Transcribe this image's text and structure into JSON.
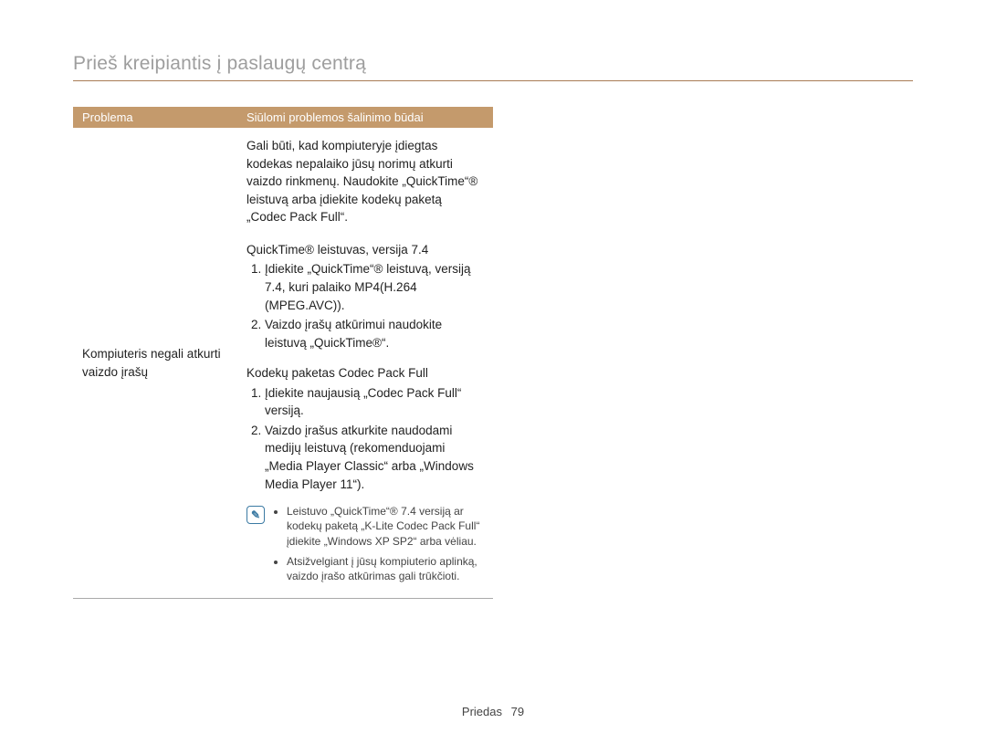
{
  "heading": "Prieš kreipiantis į paslaugų centrą",
  "table": {
    "headers": {
      "problem": "Problema",
      "solution": "Siūlomi problemos šalinimo būdai"
    },
    "row": {
      "problem": "Kompiuteris negali atkurti vaizdo įrašų",
      "intro": "Gali būti, kad kompiuteryje įdiegtas kodekas nepalaiko jūsų norimų atkurti vaizdo rinkmenų. Naudokite „QuickTime“® leistuvą arba įdiekite kodekų paketą „Codec Pack Full“.",
      "groupA": {
        "title": "QuickTime® leistuvas, versija 7.4",
        "steps": [
          "Įdiekite „QuickTime“® leistuvą, versiją 7.4, kuri palaiko MP4(H.264 (MPEG.AVC)).",
          "Vaizdo įrašų atkūrimui naudokite leistuvą „QuickTime®“."
        ]
      },
      "groupB": {
        "title": "Kodekų paketas Codec Pack Full",
        "steps": [
          "Įdiekite naujausią „Codec Pack Full“ versiją.",
          "Vaizdo įrašus atkurkite naudodami medijų leistuvą (rekomenduojami „Media Player Classic“ arba „Windows Media Player 11“)."
        ]
      },
      "notes": [
        "Leistuvo „QuickTime“® 7.4 versiją ar kodekų paketą „K-Lite Codec Pack Full“ įdiekite „Windows XP SP2“ arba vėliau.",
        "Atsižvelgiant į jūsų kompiuterio aplinką, vaizdo įrašo atkūrimas gali trūkčioti."
      ]
    }
  },
  "footer": {
    "label": "Priedas",
    "page": "79"
  },
  "icons": {
    "note": "✎"
  }
}
